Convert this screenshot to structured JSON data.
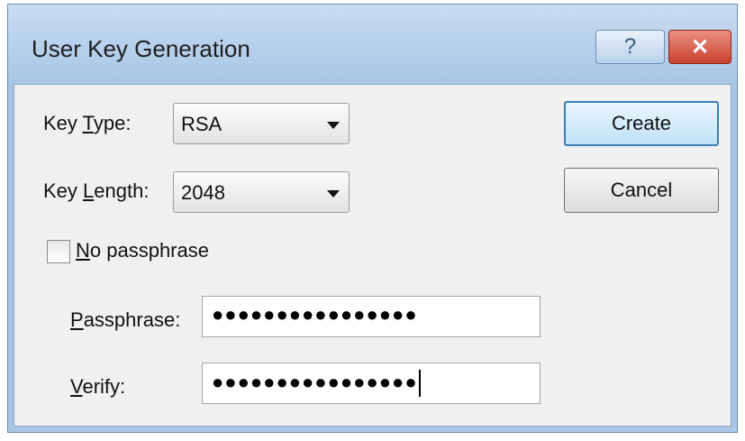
{
  "window": {
    "title": "User Key Generation",
    "help_glyph": "?",
    "close_glyph": "✕"
  },
  "form": {
    "key_type": {
      "label_pre": "Key ",
      "label_mnemonic": "T",
      "label_post": "ype:",
      "value": "RSA"
    },
    "key_length": {
      "label_pre": "Key ",
      "label_mnemonic": "L",
      "label_post": "ength:",
      "value": "2048"
    },
    "no_passphrase": {
      "label_mnemonic": "N",
      "label_post": "o passphrase",
      "checked": false
    },
    "passphrase": {
      "label_mnemonic": "P",
      "label_post": "assphrase:",
      "value": "●●●●●●●●●●●●●●●●"
    },
    "verify": {
      "label_mnemonic": "V",
      "label_post": "erify:",
      "value": "●●●●●●●●●●●●●●●●"
    }
  },
  "buttons": {
    "create": "Create",
    "cancel": "Cancel"
  }
}
